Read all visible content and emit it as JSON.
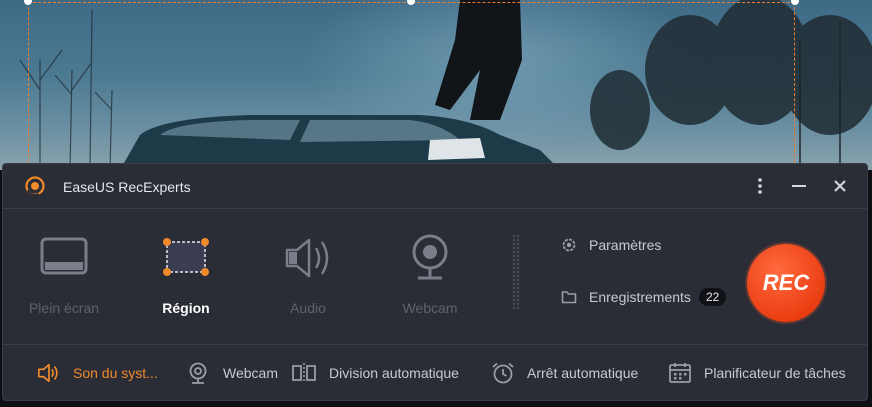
{
  "app": {
    "title": "EaseUS RecExperts"
  },
  "colors": {
    "accent": "#f08a2b",
    "rec": "#ea3e12",
    "panel": "#2a2c36"
  },
  "modes": [
    {
      "label": "Plein écran",
      "icon": "fullscreen-icon",
      "selected": false
    },
    {
      "label": "Région",
      "icon": "region-icon",
      "selected": true
    },
    {
      "label": "Audio",
      "icon": "speaker-icon",
      "selected": false
    },
    {
      "label": "Webcam",
      "icon": "webcam-icon",
      "selected": false
    }
  ],
  "side": {
    "settings_label": "Paramètres",
    "recordings_label": "Enregistrements",
    "recordings_count": "22"
  },
  "rec": {
    "label": "REC"
  },
  "bottom": {
    "system_sound": "Son du syst...",
    "webcam": "Webcam",
    "auto_split": "Division automatique",
    "auto_stop": "Arrêt automatique",
    "scheduler": "Planificateur de tâches"
  }
}
